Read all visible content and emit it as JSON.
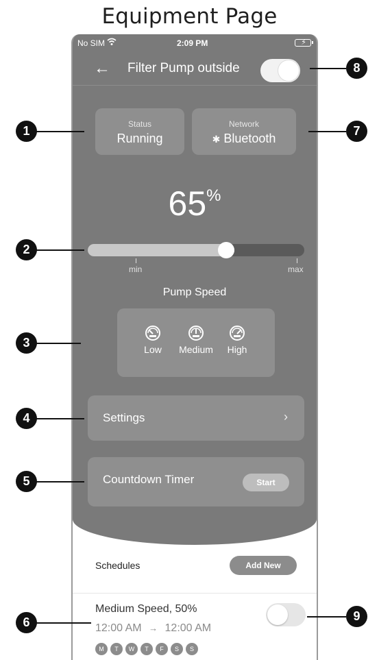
{
  "heading": "Equipment Page",
  "status_bar": {
    "carrier": "No SIM",
    "time": "2:09 PM"
  },
  "nav": {
    "back_icon": "arrow-left-icon",
    "title": "Filter Pump outside",
    "power_on": true
  },
  "status_card": {
    "label": "Status",
    "value": "Running"
  },
  "network_card": {
    "label": "Network",
    "icon": "bluetooth-icon",
    "value": "Bluetooth"
  },
  "speed": {
    "value": "65",
    "unit": "%",
    "level": 0.65,
    "min_label": "min",
    "max_label": "max"
  },
  "pump_speed": {
    "title": "Pump Speed",
    "presets": [
      {
        "label": "Low",
        "icon": "gauge-low-icon"
      },
      {
        "label": "Medium",
        "icon": "gauge-medium-icon"
      },
      {
        "label": "High",
        "icon": "gauge-high-icon"
      }
    ]
  },
  "settings": {
    "label": "Settings",
    "chevron": "›"
  },
  "countdown": {
    "label": "Countdown Timer",
    "button": "Start"
  },
  "schedules": {
    "label": "Schedules",
    "add_button": "Add New",
    "items": [
      {
        "title": "Medium Speed, 50%",
        "start": "12:00 AM",
        "arrow": "→",
        "end": "12:00 AM",
        "enabled": false,
        "days": [
          "M",
          "T",
          "W",
          "T",
          "F",
          "S",
          "S"
        ]
      }
    ]
  },
  "callouts": [
    "1",
    "2",
    "3",
    "4",
    "5",
    "6",
    "7",
    "8",
    "9"
  ],
  "colors": {
    "panel": "#7a7a7a",
    "card": "#8f8f8f",
    "callout": "#111111"
  }
}
